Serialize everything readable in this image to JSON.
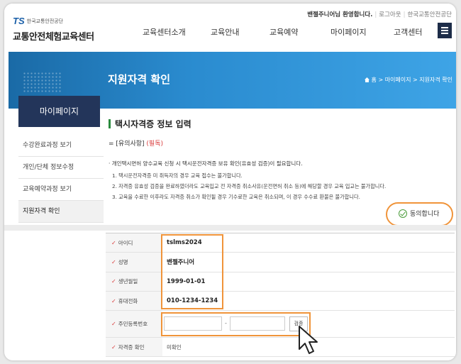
{
  "header": {
    "welcome_name": "밴젤주니어님 환영합니다.",
    "logout": "로그아웃",
    "org_link": "한국교통안전공단",
    "logo_ts": "TS",
    "logo_sub": "한국교통안전공단",
    "logo_main": "교통안전체험교육센터"
  },
  "nav": [
    "교육센터소개",
    "교육안내",
    "교육예약",
    "마이페이지",
    "고객센터"
  ],
  "banner": {
    "title": "지원자격 확인",
    "breadcrumb": [
      "홈",
      "마이페이지",
      "지원자격 확인"
    ]
  },
  "sidebar": {
    "title": "마이페이지",
    "items": [
      "수강완료과정 보기",
      "개인/단체 정보수정",
      "교육예약과정 보기",
      "지원자격 확인"
    ],
    "active_index": 3
  },
  "content": {
    "section_title": "택시자격증 정보 입력",
    "notice_title": "= [유의사항]",
    "notice_required": "(필독)",
    "notice_lead": "· 개인택시면허 양수교육 신청 시 택시운전자격증 보유 확인(유효성 검증)이 필요합니다.",
    "notices": [
      "1. 택시운전자격증 미 취득자의 경우 교육 접수는 불가합니다.",
      "2. 자격증 유효성 검증을 완료하였더라도 교육입교 전 자격증 취소사유(운전면허 취소 등)에 해당할 경우 교육 입교는 불가합니다.",
      "3. 교육을 수료한 이후라도 자격증 취소가 확인될 경우 기수료한 교육은 취소되며, 이 경우 수수료 환불은 불가합니다."
    ],
    "agree_label": "동의합니다"
  },
  "form": {
    "rows": [
      {
        "label": "아이디",
        "value": "tslms2024"
      },
      {
        "label": "성명",
        "value": "밴젤주니어"
      },
      {
        "label": "생년월일",
        "value": "1999-01-01"
      },
      {
        "label": "휴대전화",
        "value": "010-1234-1234"
      },
      {
        "label": "주민등록번호",
        "value": ""
      },
      {
        "label": "자격증 확인",
        "value": "미확인"
      }
    ],
    "rrn_dash": "-",
    "rrn_button": "검증"
  },
  "colors": {
    "highlight": "#f0943a",
    "sidebar_head": "#23355a",
    "banner": "#2a8bcf",
    "required": "#d93a3a"
  }
}
